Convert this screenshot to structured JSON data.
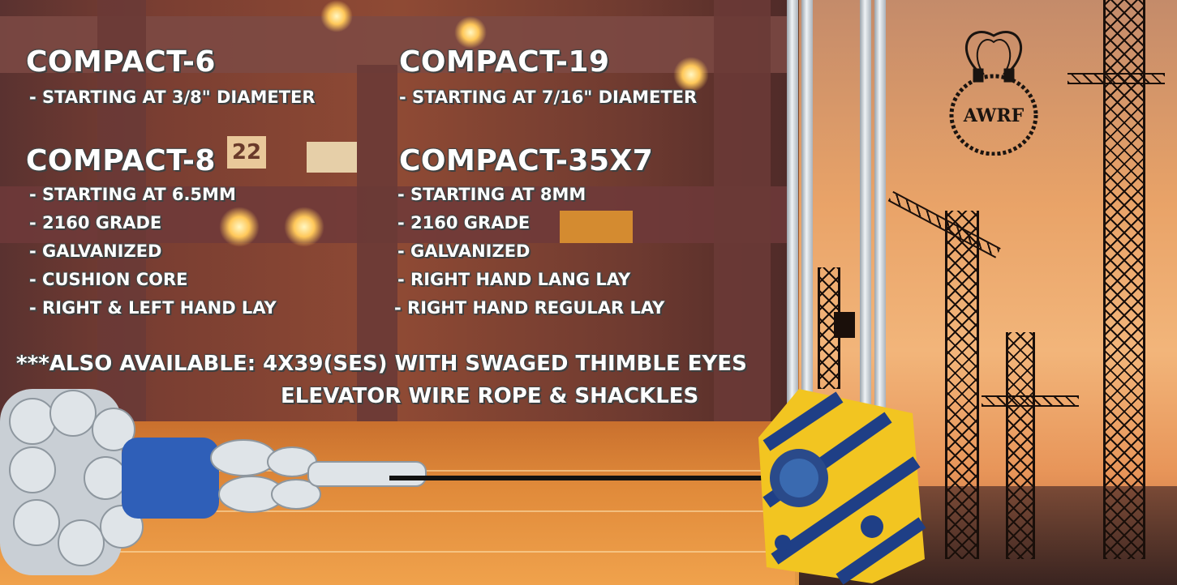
{
  "products": [
    {
      "name": "COMPACT-6",
      "specs": [
        "- STARTING AT 3/8\" DIAMETER"
      ]
    },
    {
      "name": "COMPACT-19",
      "specs": [
        "- STARTING AT 7/16\" DIAMETER"
      ]
    },
    {
      "name": "COMPACT-8",
      "specs": [
        "- STARTING AT 6.5MM",
        "- 2160 GRADE",
        "- GALVANIZED",
        "- CUSHION CORE",
        "- RIGHT & LEFT HAND LAY"
      ]
    },
    {
      "name": "COMPACT-35X7",
      "specs": [
        "- STARTING AT 8MM",
        "- 2160 GRADE",
        "- GALVANIZED",
        "- RIGHT HAND LANG LAY",
        "- RIGHT HAND REGULAR LAY"
      ]
    }
  ],
  "note": {
    "line1": "***ALSO AVAILABLE: 4X39(SES) WITH SWAGED THIMBLE EYES",
    "line2": "ELEVATOR WIRE ROPE & SHACKLES"
  },
  "background_sign": "22",
  "logo": {
    "text": "AWRF",
    "icon": "wire-rope-sling-icon"
  },
  "colors": {
    "text": "#ffffff",
    "sky": "#e9a368",
    "rope_core": "#2f5fb8",
    "sheave_yellow": "#f2c521",
    "sheave_blue": "#1f3f86"
  }
}
